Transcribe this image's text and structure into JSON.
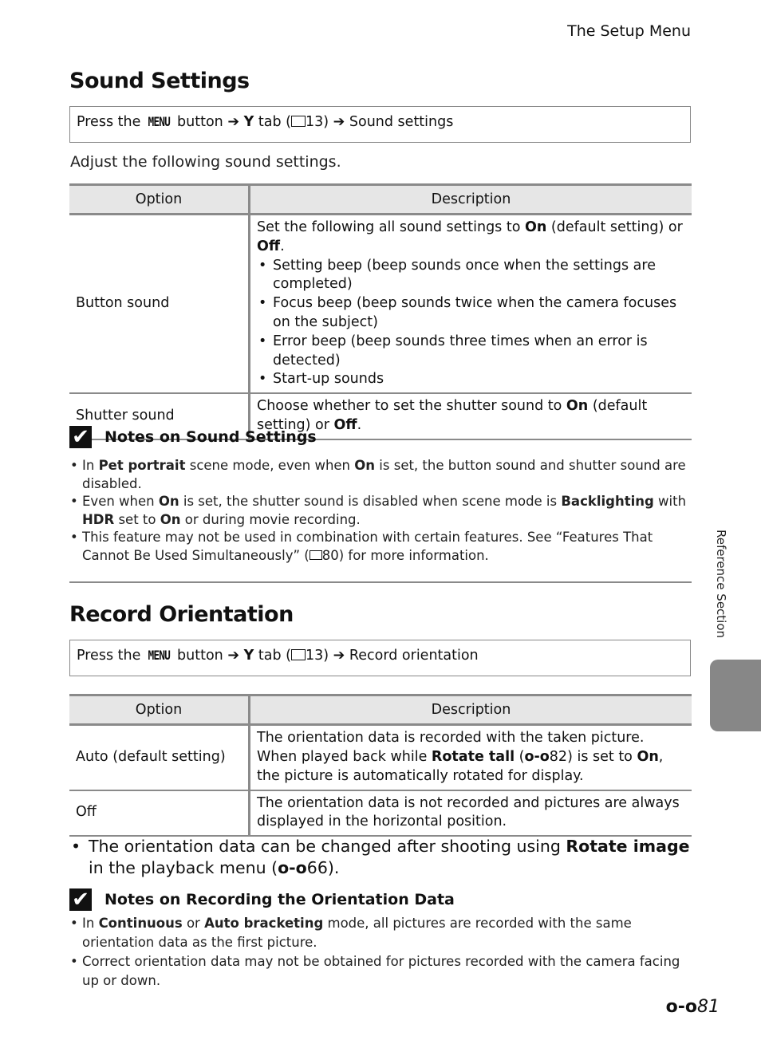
{
  "header": {
    "section_title": "The Setup Menu"
  },
  "sound_settings": {
    "title": "Sound Settings",
    "path": {
      "prefix": "Press the",
      "menu_word": "MENU",
      "button": "button",
      "arrow": "➔",
      "tab_icon": "wrench-icon",
      "tab_label": "tab (",
      "book_icon": "book-icon",
      "page_ref": "13)",
      "destination": "Sound settings"
    },
    "intro": "Adjust the following sound settings.",
    "table": {
      "headers": [
        "Option",
        "Description"
      ],
      "rows": [
        {
          "option": "Button sound",
          "desc_pre": "Set the following all sound settings to ",
          "desc_on": "On",
          "desc_mid": " (default setting) or ",
          "desc_off": "Off",
          "desc_end": ".",
          "bullets": [
            "Setting beep (beep sounds once when the settings are completed)",
            "Focus beep (beep sounds twice when the camera focuses on the subject)",
            "Error beep (beep sounds three times when an error is detected)",
            "Start-up sounds"
          ]
        },
        {
          "option": "Shutter sound",
          "desc_pre": "Choose whether to set the shutter sound to ",
          "desc_on": "On",
          "desc_mid": " (default setting) or ",
          "desc_off": "Off",
          "desc_end": "."
        }
      ]
    },
    "notes": {
      "title": "Notes on Sound Settings",
      "items": [
        {
          "a": "In ",
          "b1": "Pet portrait",
          "c": " scene mode, even when ",
          "b2": "On",
          "d": " is set, the button sound and shutter sound are disabled."
        },
        {
          "a": "Even when ",
          "b1": "On",
          "c": " is set, the shutter sound is disabled when scene mode is ",
          "b2": "Backlighting",
          "d": " with ",
          "b3": "HDR",
          "e": " set to ",
          "b4": "On",
          "f": " or during movie recording."
        },
        {
          "a": "This feature may not be used in combination with certain features. See “Features That Cannot Be Used Simultaneously” (",
          "ref": "80",
          "d": ") for more information."
        }
      ]
    }
  },
  "record_orientation": {
    "title": "Record Orientation",
    "path": {
      "prefix": "Press the",
      "menu_word": "MENU",
      "button": "button",
      "arrow": "➔",
      "tab_label": "tab (",
      "page_ref": "13)",
      "destination": "Record orientation"
    },
    "table": {
      "headers": [
        "Option",
        "Description"
      ],
      "rows": [
        {
          "option": "Auto (default setting)",
          "a": "The orientation data is recorded with the taken picture. When played back while ",
          "b1": "Rotate tall",
          "c": " (",
          "ref": "82",
          "d": ") is set to ",
          "b2": "On",
          "e": ", the picture is automatically rotated for display."
        },
        {
          "option": "Off",
          "a": "The orientation data is not recorded and pictures are always displayed in the horizontal position."
        }
      ]
    },
    "bullet": {
      "a": "The orientation data can be changed after shooting using ",
      "b": "Rotate image",
      "c": " in the playback menu (",
      "ref": "66",
      "d": ")."
    },
    "notes": {
      "title": "Notes on Recording the Orientation Data",
      "items": [
        {
          "a": "In ",
          "b1": "Continuous",
          "c": " or ",
          "b2": "Auto bracketing",
          "d": " mode, all pictures are recorded with the same orientation data as the first picture."
        },
        {
          "a": "Correct orientation data may not be obtained for pictures recorded with the camera facing up or down."
        }
      ]
    }
  },
  "sidebar": {
    "label": "Reference Section"
  },
  "footer": {
    "ref_icon": "binoculars-icon",
    "page_number": "81"
  },
  "icons": {
    "ref_glyph": "♾",
    "book_glyph": "□",
    "wrench_glyph": "Y"
  }
}
